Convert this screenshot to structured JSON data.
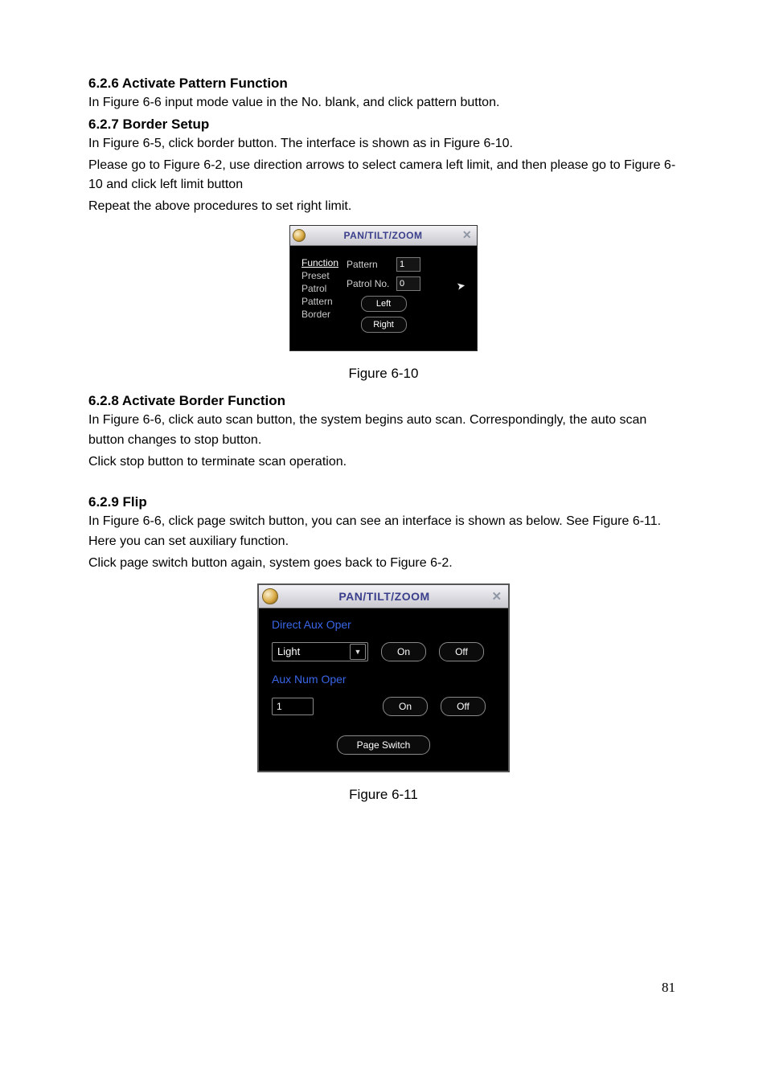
{
  "s626": {
    "heading": "6.2.6  Activate Pattern Function",
    "p1": "In Figure 6-6 input mode value in the No. blank, and click pattern button."
  },
  "s627": {
    "heading": "6.2.7  Border Setup",
    "p1": "In Figure 6-5, click border button. The interface is shown as in Figure 6-10.",
    "p2": "Please go to Figure 6-2, use direction arrows to select camera left limit, and then please go to Figure 6-10 and click left limit button",
    "p3": "Repeat the above procedures to set right limit."
  },
  "fig610": {
    "title": "PAN/TILT/ZOOM",
    "menu": [
      "Function",
      "Preset",
      "Patrol",
      "Pattern",
      "Border"
    ],
    "active_menu_index": 0,
    "pattern_label": "Pattern",
    "pattern_value": "1",
    "patrolno_label": "Patrol No.",
    "patrolno_value": "0",
    "btn_left": "Left",
    "btn_right": "Right",
    "caption": "Figure 6-10"
  },
  "s628": {
    "heading": "6.2.8  Activate Border Function",
    "p1": "In Figure 6-6, click auto scan button, the system begins auto scan. Correspondingly, the auto scan button changes to stop button.",
    "p2": "Click stop button to terminate scan operation."
  },
  "s629": {
    "heading": "6.2.9      Flip",
    "p1": "In Figure 6-6, click page switch button, you can see an interface is shown as below. See Figure 6-11. Here you can set auxiliary function.",
    "p2": "Click page switch button again, system goes back to Figure 6-2."
  },
  "fig611": {
    "title": "PAN/TILT/ZOOM",
    "direct_aux_label": "Direct Aux Oper",
    "select_value": "Light",
    "btn_on": "On",
    "btn_off": "Off",
    "aux_num_label": "Aux Num Oper",
    "aux_num_value": "1",
    "btn_page_switch": "Page Switch",
    "caption": "Figure 6-11"
  },
  "page_number": "81"
}
